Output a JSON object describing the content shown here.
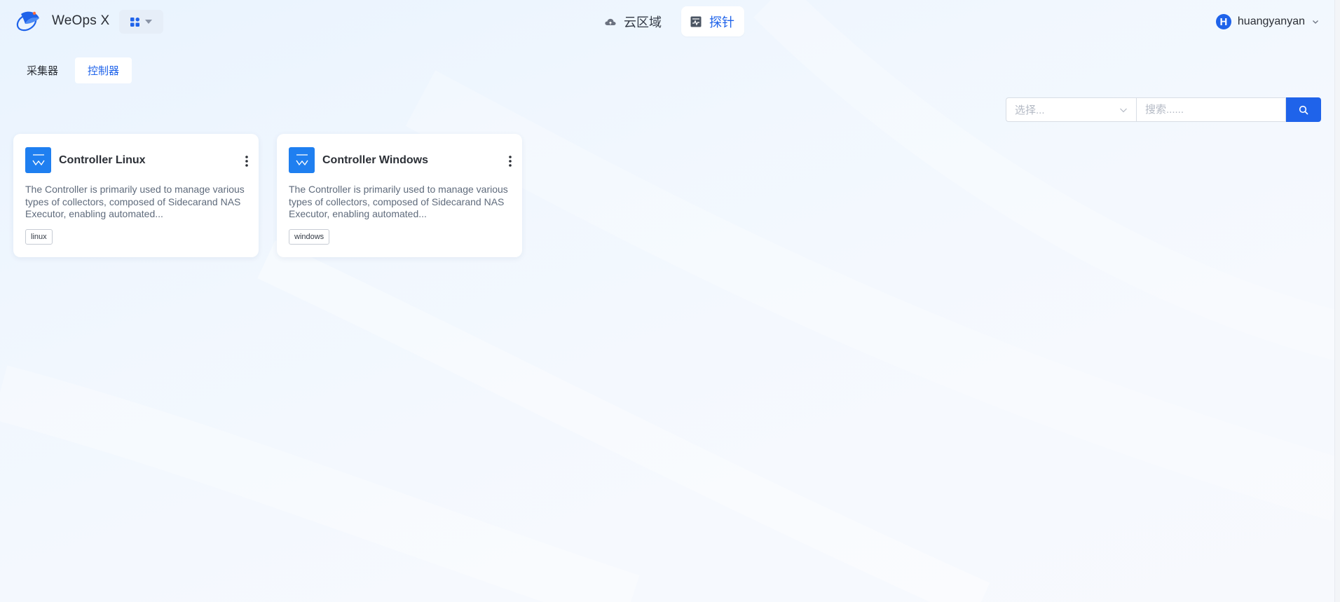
{
  "app": {
    "name": "WeOps X"
  },
  "topnav": [
    {
      "label": "云区域",
      "icon": "cloud-icon",
      "active": false
    },
    {
      "label": "探针",
      "icon": "probe-icon",
      "active": true
    }
  ],
  "user": {
    "initial": "H",
    "name": "huangyanyan"
  },
  "tabs": [
    {
      "label": "采集器",
      "active": false
    },
    {
      "label": "控制器",
      "active": true
    }
  ],
  "search": {
    "select_placeholder": "选择...",
    "input_placeholder": "搜索......"
  },
  "cards": [
    {
      "title": "Controller Linux",
      "description": "The Controller is primarily used to manage various types of collectors, composed of Sidecarand NAS Executor, enabling automated...",
      "tag": "linux"
    },
    {
      "title": "Controller Windows",
      "description": "The Controller is primarily used to manage various types of collectors, composed of Sidecarand NAS Executor, enabling automated...",
      "tag": "windows"
    }
  ],
  "colors": {
    "accent": "#1f63ea",
    "card_icon": "#1f7ff0"
  }
}
